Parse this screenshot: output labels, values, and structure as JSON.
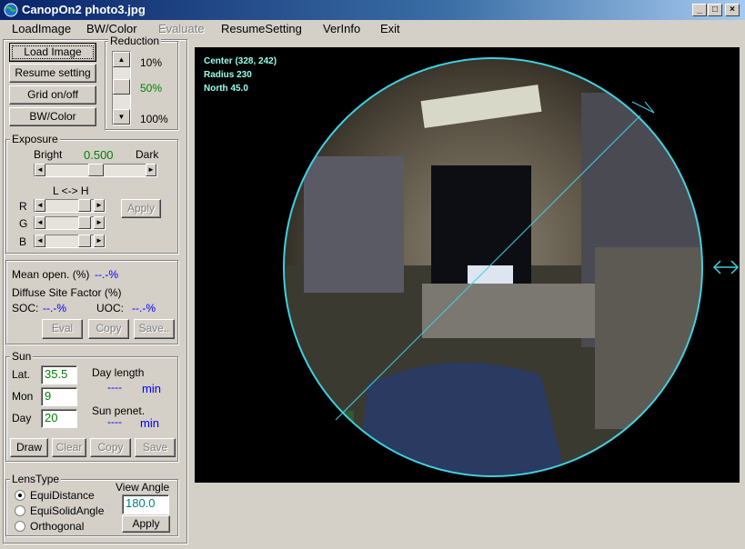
{
  "window": {
    "title": "CanopOn2  photo3.jpg",
    "minimize": "_",
    "maximize": "□",
    "close": "×"
  },
  "menu": {
    "items": [
      {
        "label": "LoadImage",
        "enabled": true
      },
      {
        "label": "BW/Color",
        "enabled": true
      },
      {
        "label": "Evaluate",
        "enabled": false
      },
      {
        "label": "ResumeSetting",
        "enabled": true
      },
      {
        "label": "VerInfo",
        "enabled": true
      },
      {
        "label": "Exit",
        "enabled": true
      }
    ]
  },
  "top_buttons": {
    "load_image": "Load Image",
    "resume_setting": "Resume setting",
    "grid": "Grid on/off",
    "bw_color": "BW/Color"
  },
  "reduction": {
    "label": "Reduction",
    "opt1": "10%",
    "opt2": "50%",
    "opt3": "100%",
    "up": "▲",
    "down": "▼"
  },
  "exposure": {
    "label": "Exposure",
    "bright": "Bright",
    "value": "0.500",
    "dark": "Dark",
    "lh_label": "L <-> H",
    "r": "R",
    "g": "G",
    "b": "B",
    "apply": "Apply",
    "left_arrow": "◄",
    "right_arrow": "►"
  },
  "results": {
    "mean_open_label": "Mean open. (%)",
    "mean_open_value": "--.-%",
    "dsf_label": "Diffuse Site Factor (%)",
    "soc_label": "SOC:",
    "soc_value": "--.-%",
    "uoc_label": "UOC:",
    "uoc_value": "--.-%",
    "eval": "Eval",
    "copy": "Copy",
    "save": "Save.."
  },
  "sun": {
    "label": "Sun",
    "lat_label": "Lat.",
    "lat_value": "35.5",
    "mon_label": "Mon",
    "mon_value": "9",
    "day_label": "Day",
    "day_value": "20",
    "day_length_label": "Day length",
    "day_length_value": "----",
    "day_length_unit": "min",
    "sun_penet_label": "Sun penet.",
    "sun_penet_value": "----",
    "sun_penet_unit": "min",
    "draw": "Draw",
    "clear": "Clear",
    "copy": "Copy",
    "save": "Save"
  },
  "lens": {
    "label": "LensType",
    "opt1": "EquiDistance",
    "opt2": "EquiSolidAngle",
    "opt3": "Orthogonal",
    "selected": "EquiDistance",
    "view_angle_label": "View Angle",
    "view_angle_value": "180.0",
    "apply": "Apply"
  },
  "overlay": {
    "center": "Center (328, 242)",
    "radius": "Radius 230",
    "north": "North 45.0"
  },
  "colors": {
    "titlebar_start": "#0a246a",
    "titlebar_end": "#a6caf0",
    "circle": "#3fd0e0",
    "status_blue": "#0000ff",
    "value_green": "#008000"
  }
}
